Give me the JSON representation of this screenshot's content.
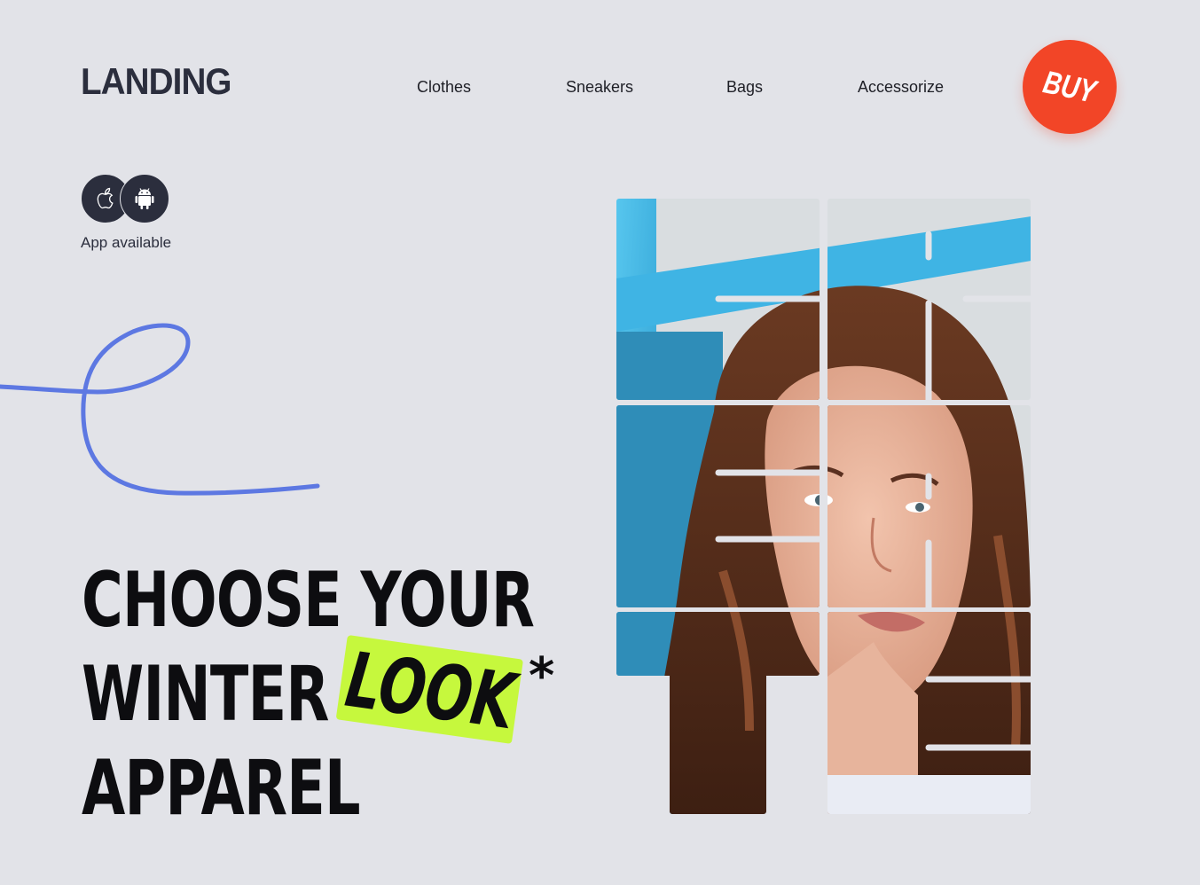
{
  "brand": {
    "logo": "LANDING"
  },
  "nav": {
    "items": [
      {
        "label": "Clothes"
      },
      {
        "label": "Sneakers"
      },
      {
        "label": "Bags"
      },
      {
        "label": "Accessorize"
      }
    ]
  },
  "cta": {
    "buy_label": "BUY",
    "color": "#f24527"
  },
  "app": {
    "label": "App available",
    "icons": [
      "apple-icon",
      "android-icon"
    ]
  },
  "hero": {
    "headline_line1": "CHOOSE YOUR",
    "headline_line2": "WINTER",
    "headline_line3": "APPAREL",
    "highlight_word": "LOOK",
    "asterisk": "*",
    "highlight_color": "#c6f83d",
    "squiggle_color": "#5d78e2"
  },
  "colors": {
    "background": "#e2e3e8",
    "text_dark": "#2b2e3d"
  }
}
